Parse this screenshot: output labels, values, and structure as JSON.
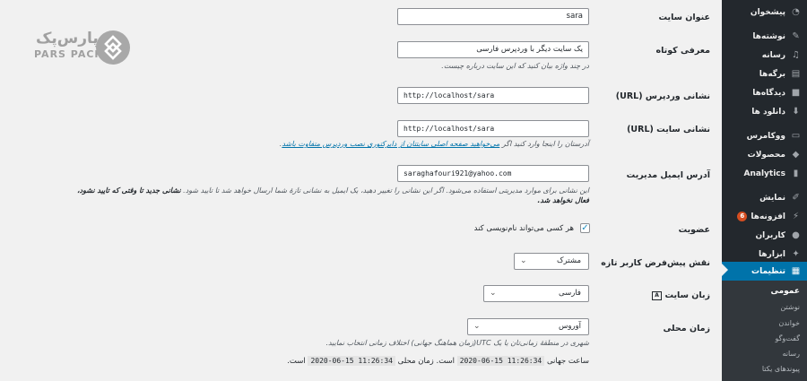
{
  "sidebar": {
    "items": [
      {
        "label": "پیشخوان",
        "icon": "dashboard-icon"
      },
      {
        "label": "نوشته‌ها",
        "icon": "pushpin-icon"
      },
      {
        "label": "رسانه",
        "icon": "media-icon"
      },
      {
        "label": "برگه‌ها",
        "icon": "page-icon"
      },
      {
        "label": "دیدگاه‌ها",
        "icon": "comment-icon"
      },
      {
        "label": "دانلود ها",
        "icon": "download-icon"
      },
      {
        "label": "ووکامرس",
        "icon": "woocommerce-icon"
      },
      {
        "label": "محصولات",
        "icon": "products-icon"
      },
      {
        "label": "Analytics",
        "icon": "bar-chart-icon"
      },
      {
        "label": "نمایش",
        "icon": "paintbrush-icon"
      },
      {
        "label": "افزونه‌ها",
        "icon": "plugin-icon",
        "badge": "6"
      },
      {
        "label": "کاربران",
        "icon": "user-icon"
      },
      {
        "label": "ابزارها",
        "icon": "wrench-icon"
      },
      {
        "label": "تنظیمات",
        "icon": "settings-icon",
        "active": true
      }
    ],
    "submenu": [
      "عمومی",
      "نوشتن",
      "خواندن",
      "گفت‌وگو",
      "رسانه",
      "پیوندهای یکتا"
    ]
  },
  "logo": {
    "fa": "پارس‌پک",
    "en": "PARS PACK"
  },
  "form": {
    "site_title": {
      "label": "عنوان سایت",
      "value": "sara"
    },
    "tagline": {
      "label": "معرفی کوتاه",
      "value": "یک سایت دیگر با وردپرس فارسی",
      "desc": "در چند واژه بیان کنید که این سایت درباره چیست."
    },
    "wp_url": {
      "label": "نشانی وردپرس (URL)",
      "value": "http://localhost/sara"
    },
    "site_url": {
      "label": "نشانی سایت (URL)",
      "value": "http://localhost/sara",
      "desc_before": "آدرستان را اینجا وارد کنید اگر",
      "desc_link": "می‌خواهید صفحه اصلی سایتتان از دایرکتوری نصب وردپرس متفاوت باشد",
      "desc_after": "."
    },
    "admin_email": {
      "label": "آدرس ایمیل مدیریت",
      "value": "saraghafouri921@yahoo.com",
      "desc1": "این نشانی برای موارد مدیریتی استفاده می‌شود. اگر این نشانی را تغییر دهید، یک ایمیل به نشانی تازهٔ شما ارسال خواهد شد تا تایید شود.",
      "desc1_bold": "نشانی جدید تا وقتی که تایید نشود،",
      "desc2_bold": "فعال نخواهد شد."
    },
    "membership": {
      "label": "عضویت",
      "checkbox_label": "هر کسی می‌تواند نام‌نویسی کند",
      "checked": "✓"
    },
    "default_role": {
      "label": "نقش پیش‌فرض کاربر تازه",
      "value": "مشترک"
    },
    "site_language": {
      "label": "زبان سایت",
      "value": "فارسی"
    },
    "timezone": {
      "label": "زمان محلی",
      "value": "آوروس",
      "desc": "شهری در منطقهٔ زمانی‌تان یا یک UTC(زمان هماهنگ جهانی) اختلاف زمانی انتخاب نمایید.",
      "utc_label": "ساعت جهانی",
      "utc_value": "2020-06-15 11:26:34",
      "local_prefix": "است. زمان محلی",
      "local_value": "2020-06-15 11:26:34",
      "local_suffix": "است."
    }
  }
}
